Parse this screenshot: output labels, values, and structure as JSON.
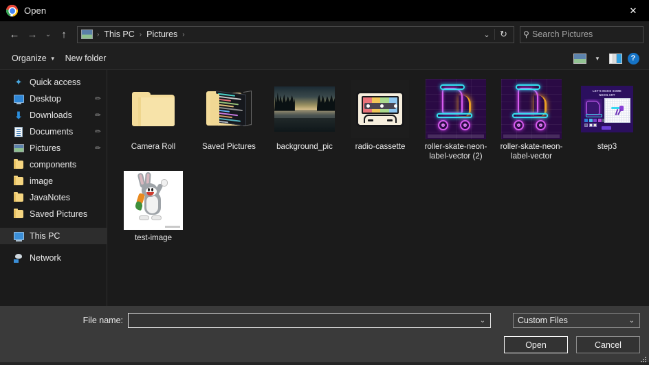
{
  "window": {
    "title": "Open",
    "app_icon": "chrome-logo-icon",
    "close_label": "✕"
  },
  "nav": {
    "back_icon": "←",
    "forward_icon": "→",
    "recent_icon": "⌄",
    "up_icon": "↑",
    "breadcrumb": [
      "This PC",
      "Pictures"
    ],
    "separator": "›",
    "dropdown_icon": "⌄",
    "refresh_icon": "↻"
  },
  "search": {
    "placeholder": "Search Pictures",
    "value": "",
    "icon": "search-icon"
  },
  "toolbar": {
    "organize_label": "Organize",
    "organize_caret": "▼",
    "new_folder_label": "New folder",
    "view_icon": "view-layout-icon",
    "view_caret": "▼",
    "preview_pane_icon": "preview-pane-icon",
    "help_icon": "?"
  },
  "sidebar": {
    "items": [
      {
        "label": "Quick access",
        "icon": "star-icon",
        "level": 0,
        "pinned": false,
        "selected": false
      },
      {
        "label": "Desktop",
        "icon": "monitor-icon",
        "level": 1,
        "pinned": true,
        "selected": false
      },
      {
        "label": "Downloads",
        "icon": "download-icon",
        "level": 1,
        "pinned": true,
        "selected": false
      },
      {
        "label": "Documents",
        "icon": "document-icon",
        "level": 1,
        "pinned": true,
        "selected": false
      },
      {
        "label": "Pictures",
        "icon": "pictures-icon",
        "level": 1,
        "pinned": true,
        "selected": false
      },
      {
        "label": "components",
        "icon": "folder-icon",
        "level": 1,
        "pinned": false,
        "selected": false
      },
      {
        "label": "image",
        "icon": "folder-icon",
        "level": 1,
        "pinned": false,
        "selected": false
      },
      {
        "label": "JavaNotes",
        "icon": "folder-icon",
        "level": 1,
        "pinned": false,
        "selected": false
      },
      {
        "label": "Saved Pictures",
        "icon": "folder-icon",
        "level": 1,
        "pinned": false,
        "selected": false
      },
      {
        "label": "This PC",
        "icon": "this-pc-icon",
        "level": 0,
        "pinned": false,
        "selected": true
      },
      {
        "label": "Network",
        "icon": "network-icon",
        "level": 0,
        "pinned": false,
        "selected": false
      }
    ],
    "pin_glyph": "✐"
  },
  "files": [
    {
      "name": "Camera Roll",
      "kind": "folder",
      "thumb": "empty-folder"
    },
    {
      "name": "Saved Pictures",
      "kind": "folder",
      "thumb": "folder-with-preview"
    },
    {
      "name": "background_pic",
      "kind": "image",
      "thumb": "landscape-lake-photo"
    },
    {
      "name": "radio-cassette",
      "kind": "image",
      "thumb": "cassette-tape-illustration"
    },
    {
      "name": "roller-skate-neon-label-vector (2)",
      "kind": "image",
      "thumb": "neon-roller-skate"
    },
    {
      "name": "roller-skate-neon-label-vector",
      "kind": "image",
      "thumb": "neon-roller-skate"
    },
    {
      "name": "step3",
      "kind": "image",
      "thumb": "design-tool-screenshot"
    },
    {
      "name": "test-image",
      "kind": "image",
      "thumb": "bugs-bunny-cartoon"
    }
  ],
  "footer": {
    "file_name_label": "File name:",
    "file_name_value": "",
    "file_name_placeholder": "",
    "file_name_caret": "⌄",
    "filter_value": "Custom Files",
    "filter_caret": "⌄",
    "open_label": "Open",
    "cancel_label": "Cancel"
  },
  "colors": {
    "window_bg": "#1f1f1f",
    "content_bg": "#1b1b1b",
    "titlebar_bg": "#000000",
    "footer_bg": "#3a3a3a",
    "text": "#e8e8e8",
    "accent_blue": "#1573c6",
    "selection_bg": "#2d2d2d",
    "folder_yellow": "#f4dc9a"
  }
}
